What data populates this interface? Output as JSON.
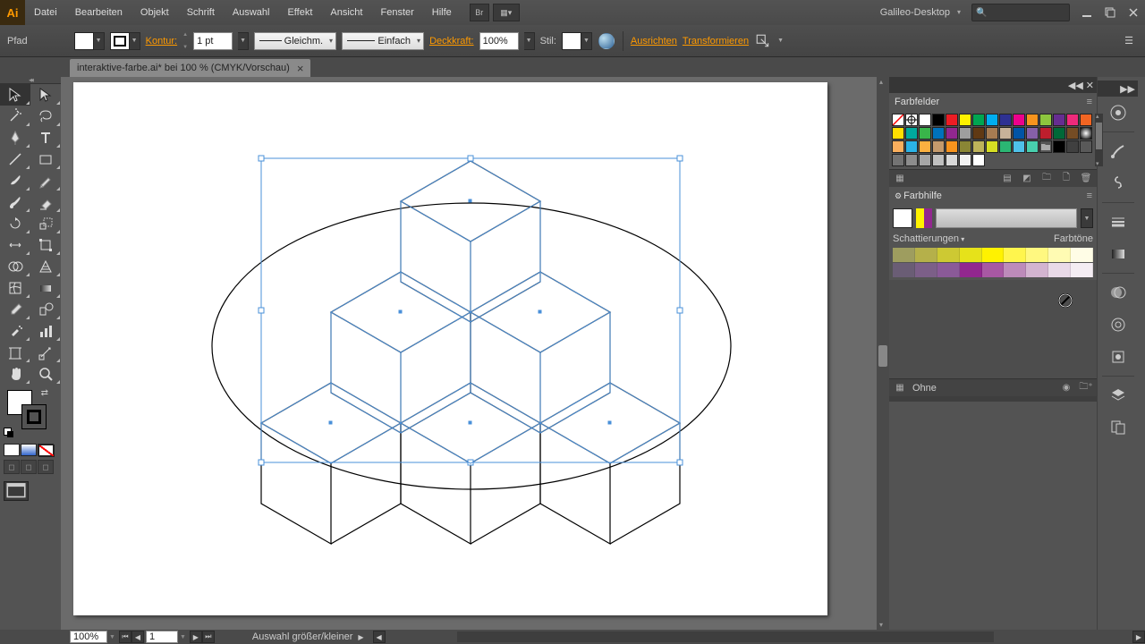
{
  "app": {
    "logo": "Ai"
  },
  "menu": [
    "Datei",
    "Bearbeiten",
    "Objekt",
    "Schrift",
    "Auswahl",
    "Effekt",
    "Ansicht",
    "Fenster",
    "Hilfe"
  ],
  "workspace": "Galileo-Desktop",
  "controlbar": {
    "selection_label": "Pfad",
    "kontur_label": "Kontur:",
    "kontur_value": "1 pt",
    "stroke_profile": "Gleichm.",
    "brush": "Einfach",
    "deckkraft_label": "Deckkraft:",
    "deckkraft_value": "100%",
    "stil_label": "Stil:",
    "ausrichten": "Ausrichten",
    "transformieren": "Transformieren"
  },
  "doc_tab": {
    "title": "interaktive-farbe.ai* bei 100 % (CMYK/Vorschau)",
    "close": "×"
  },
  "panels": {
    "swatches_title": "Farbfelder",
    "guide_title": "Farbhilfe",
    "guide_shade_label": "Schattierungen",
    "guide_tint_label": "Farbtöne",
    "guide_none": "Ohne"
  },
  "swatches": {
    "rows": [
      [
        "none",
        "reg",
        "#ffffff",
        "#000000",
        "#ed1c24",
        "#fff200",
        "#00a651",
        "#00aeef",
        "#2e3192",
        "#ec008c",
        "#f7941d",
        "#8dc63e",
        "#662d91",
        "#ee2a7b",
        "#f26522"
      ],
      [
        "#ffde00",
        "#00a99d",
        "#39b54a",
        "#0072bc",
        "#92278f",
        "#9e9e9e",
        "#603913",
        "#a67c52",
        "#c7b299",
        "#0054a6",
        "#8560a8",
        "#be1e2d",
        "#006838",
        "#754c24",
        "grad1"
      ],
      [
        "#fbaf5d",
        "#2bb3e6",
        "#fcb040",
        "#c49a6c"
      ],
      [
        "#f7941d",
        "#8a8635",
        "#beb35a",
        "#d7df23",
        "#2bb673",
        "#4fc1e9",
        "#48cfad"
      ],
      [
        "folder",
        "#000000",
        "#404040",
        "#595959",
        "#737373",
        "#8c8c8c",
        "#a6a6a6",
        "#bfbfbf",
        "#d9d9d9",
        "#f2f2f2",
        "#ffffff"
      ]
    ]
  },
  "guide_colors": {
    "active": [
      "#fff200",
      "#92278f"
    ],
    "row1": [
      "#9e9d5f",
      "#b5b04a",
      "#cdc933",
      "#e6e21a",
      "#fff200",
      "#fff54d",
      "#fff880",
      "#fffbb3",
      "#fffde6"
    ],
    "row2": [
      "#6a5d75",
      "#7c5f88",
      "#8a5a98",
      "#92278f",
      "#a858a3",
      "#bd8bba",
      "#d3b4d0",
      "#e9dae8",
      "#f4edf3"
    ]
  },
  "status": {
    "zoom": "100%",
    "page": "1",
    "text": "Auswahl größer/kleiner"
  }
}
